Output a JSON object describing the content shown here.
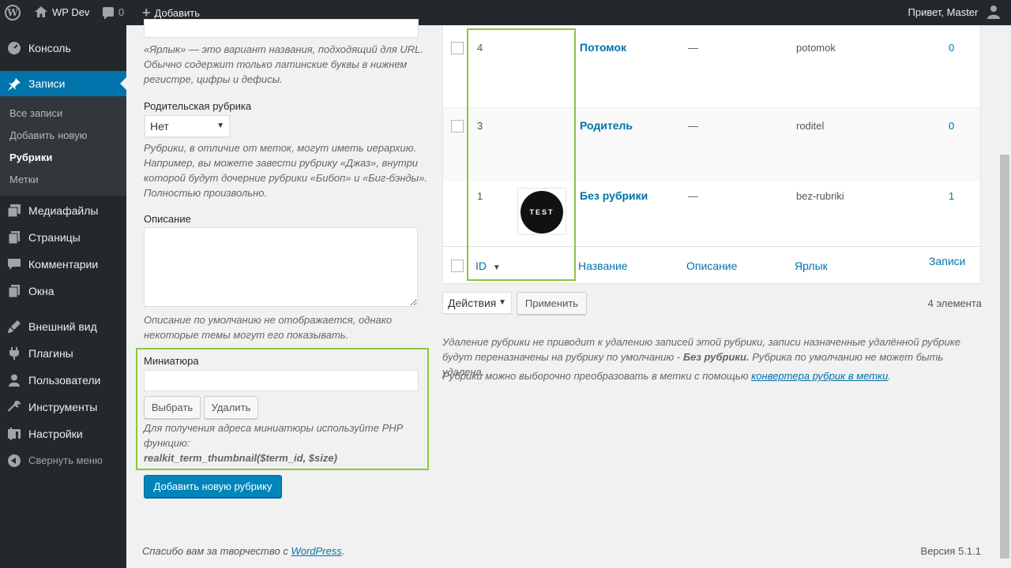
{
  "adminbar": {
    "site_name": "WP Dev",
    "comments_count": "0",
    "add_new": "Добавить",
    "greeting": "Привет, Master"
  },
  "sidebar": {
    "items": [
      {
        "label": "Консоль",
        "icon": "dashboard-icon"
      },
      {
        "label": "Записи",
        "icon": "pin-icon"
      },
      {
        "label": "Медиафайлы",
        "icon": "media-icon"
      },
      {
        "label": "Страницы",
        "icon": "pages-icon"
      },
      {
        "label": "Комментарии",
        "icon": "comments-icon"
      },
      {
        "label": "Окна",
        "icon": "widgets-icon"
      },
      {
        "label": "Внешний вид",
        "icon": "appearance-icon"
      },
      {
        "label": "Плагины",
        "icon": "plugins-icon"
      },
      {
        "label": "Пользователи",
        "icon": "users-icon"
      },
      {
        "label": "Инструменты",
        "icon": "tools-icon"
      },
      {
        "label": "Настройки",
        "icon": "settings-icon"
      }
    ],
    "submenu": [
      "Все записи",
      "Добавить новую",
      "Рубрики",
      "Метки"
    ],
    "collapse": "Свернуть меню"
  },
  "form": {
    "slug_desc": [
      "«Ярлык» — это вариант названия, подходящий для URL.",
      "Обычно содержит только латинские буквы в нижнем",
      "регистре, цифры и дефисы."
    ],
    "parent_label": "Родительская рубрика",
    "parent_value": "Нет",
    "parent_desc": [
      "Рубрики, в отличие от меток, могут иметь иерархию.",
      "Например, вы можете завести рубрику «Джаз», внутри",
      "которой будут дочерние рубрики «Бибоп» и «Биг-бэнды».",
      "Полностью произвольно."
    ],
    "description_label": "Описание",
    "description_desc": [
      "Описание по умолчанию не отображается, однако",
      "некоторые темы могут его показывать."
    ],
    "thumbnail_label": "Миниатюра",
    "choose_button": "Выбрать",
    "remove_button": "Удалить",
    "thumbnail_desc": [
      "Для получения адреса миниатюры используйте PHP",
      "функцию:"
    ],
    "thumbnail_func": "realkit_term_thumbnail($term_id, $size)",
    "submit_button": "Добавить новую рубрику"
  },
  "table": {
    "rows": [
      {
        "id": "4",
        "name": "Потомок",
        "description": "—",
        "slug": "potomok",
        "count": "0",
        "thumb": ""
      },
      {
        "id": "3",
        "name": "Родитель",
        "description": "—",
        "slug": "roditel",
        "count": "0",
        "thumb": ""
      },
      {
        "id": "1",
        "name": "Без рубрики",
        "description": "—",
        "slug": "bez-rubriki",
        "count": "1",
        "thumb": "TEST"
      }
    ],
    "headers": {
      "id": "ID",
      "name": "Название",
      "description": "Описание",
      "slug": "Ярлык",
      "posts": "Записи"
    },
    "bulk_action": "Действия",
    "apply": "Применить",
    "count_label": "4 элемента"
  },
  "notes": {
    "line1a": "Удаление рубрики не приводит к удалению записей этой рубрики, записи назначенные удалённой рубрике",
    "line1b": "будут переназначены на рубрику по умолчанию - ",
    "default_cat": "Без рубрики.",
    "line1c": " Рубрика по умолчанию не может быть удалена.",
    "line2": "Рубрики можно выборочно преобразовать в метки с помощью ",
    "converter_link": "конвертера рубрик в метки",
    "line2_end": "."
  },
  "footer": {
    "thanks": "Спасибо вам за творчество с ",
    "wp_link": "WordPress",
    "thanks_end": ".",
    "version": "Версия 5.1.1"
  },
  "colors": {
    "accent": "#0073aa",
    "highlight": "#8cc63f",
    "sidebar_bg": "#23282d"
  }
}
